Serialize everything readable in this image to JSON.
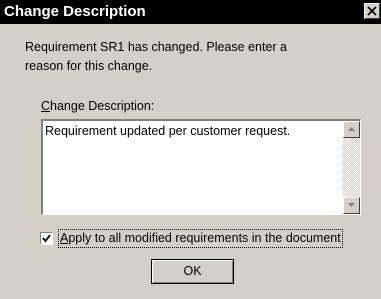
{
  "window": {
    "title": "Change Description",
    "close_glyph": "close-icon"
  },
  "message": {
    "line1": "Requirement SR1 has changed.  Please enter a",
    "line2": "reason for this change."
  },
  "description": {
    "label_mnemonic": "C",
    "label_rest": "hange Description:",
    "value": "Requirement updated per customer request."
  },
  "apply_all": {
    "checked": true,
    "label_mnemonic": "A",
    "label_rest": "pply to all modified requirements in the document"
  },
  "buttons": {
    "ok_label": "OK"
  },
  "colors": {
    "face": "#d4d0c8",
    "titlebar": "#000000"
  }
}
